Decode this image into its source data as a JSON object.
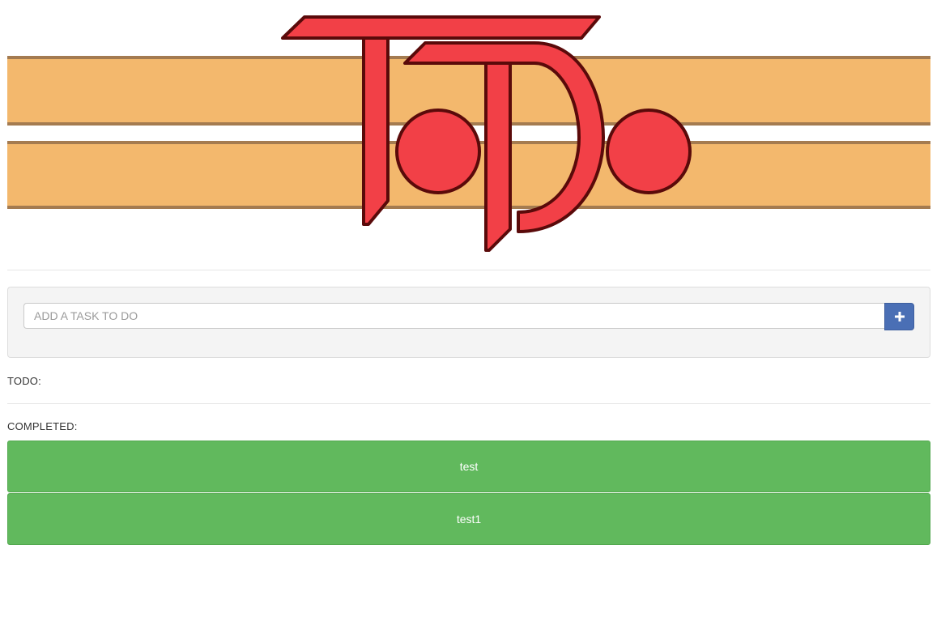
{
  "logo": {
    "text": "ToDo",
    "stripe_color": "#f3b86d",
    "stripe_border": "#a47b50",
    "letter_color": "#f24047",
    "letter_outline": "#5a0a0a"
  },
  "add_task": {
    "placeholder": "ADD A TASK TO DO",
    "value": "",
    "button_icon": "plus-icon",
    "button_color": "#4a6fb5"
  },
  "todo": {
    "label": "TODO:",
    "items": []
  },
  "completed": {
    "label": "COMPLETED:",
    "item_color": "#61b95d",
    "items": [
      {
        "title": "test"
      },
      {
        "title": "test1"
      }
    ]
  }
}
